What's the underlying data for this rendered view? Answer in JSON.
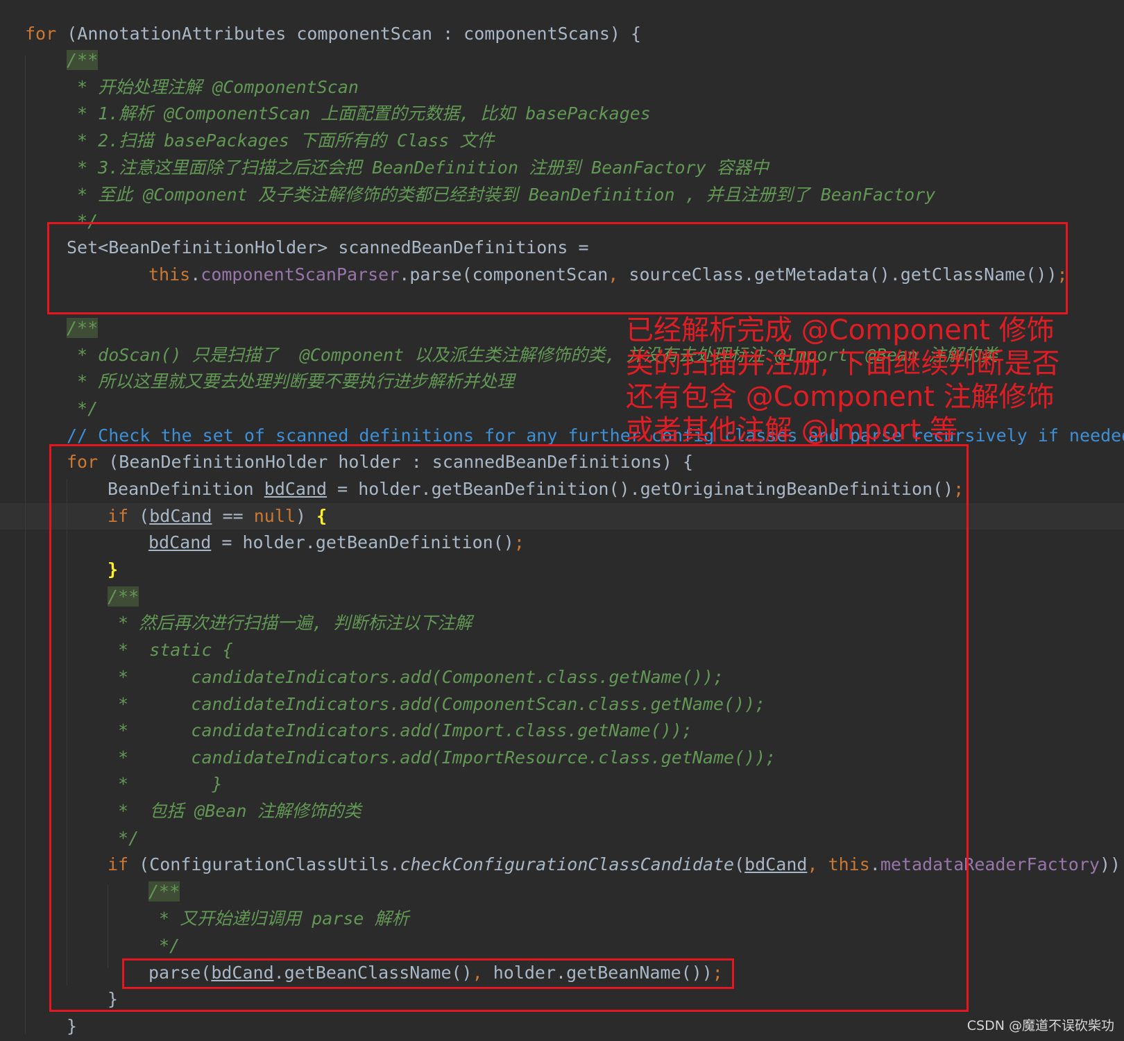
{
  "code_lines": [
    [
      {
        "t": "for ",
        "c": "kw"
      },
      {
        "t": "(AnnotationAttributes componentScan : componentScans) {"
      }
    ],
    [
      {
        "t": "/**",
        "c": "cmd"
      }
    ],
    [
      {
        "t": " * 开始处理注解 @ComponentScan",
        "c": "cm"
      }
    ],
    [
      {
        "t": " * 1.解析 @ComponentScan 上面配置的元数据, 比如 basePackages",
        "c": "cm"
      }
    ],
    [
      {
        "t": " * 2.扫描 basePackages 下面所有的 Class 文件",
        "c": "cm"
      }
    ],
    [
      {
        "t": " * 3.注意这里面除了扫描之后还会把 BeanDefinition 注册到 BeanFactory 容器中",
        "c": "cm"
      }
    ],
    [
      {
        "t": " * 至此 @Component 及子类注解修饰的类都已经封装到 BeanDefinition , 并且注册到了 BeanFactory",
        "c": "cm"
      }
    ],
    [
      {
        "t": " */",
        "c": "cm"
      }
    ],
    [
      {
        "t": "Set<BeanDefinitionHolder> scannedBeanDefinitions ="
      }
    ],
    [
      {
        "t": "this",
        "c": "kw"
      },
      {
        "t": "."
      },
      {
        "t": "componentScanParser",
        "c": "fld"
      },
      {
        "t": ".parse(componentScan"
      },
      {
        "t": ", ",
        "c": "kw"
      },
      {
        "t": "sourceClass.getMetadata().getClassName())"
      },
      {
        "t": ";",
        "c": "kw"
      }
    ],
    [
      {
        "t": "/**",
        "c": "cmd"
      }
    ],
    [
      {
        "t": " * doScan() 只是扫描了  @Component 以及派生类注解修饰的类, 并没有去处理标注 @Import、@Bean 注解的类",
        "c": "cm"
      }
    ],
    [
      {
        "t": " * 所以这里就又要去处理判断要不要执行进步解析并处理",
        "c": "cm"
      }
    ],
    [
      {
        "t": " */",
        "c": "cm"
      }
    ],
    [
      {
        "t": "// Check the set of scanned definitions for any further config classes and parse recursively if needed",
        "c": "lc"
      }
    ],
    [
      {
        "t": "for ",
        "c": "kw"
      },
      {
        "t": "(BeanDefinitionHolder holder : scannedBeanDefinitions) {"
      }
    ],
    [
      {
        "t": "BeanDefinition "
      },
      {
        "t": "bdCand",
        "c": "ul"
      },
      {
        "t": " = holder.getBeanDefinition().getOriginatingBeanDefinition()"
      },
      {
        "t": ";",
        "c": "kw"
      }
    ],
    [
      {
        "t": "if ",
        "c": "kw"
      },
      {
        "t": "("
      },
      {
        "t": "bdCand",
        "c": "ul"
      },
      {
        "t": " == "
      },
      {
        "t": "null",
        "c": "kw"
      },
      {
        "t": ") "
      },
      {
        "t": "{",
        "c": "br"
      }
    ],
    [
      {
        "t": "bdCand",
        "c": "ul"
      },
      {
        "t": " = holder.getBeanDefinition()"
      },
      {
        "t": ";",
        "c": "kw"
      }
    ],
    [
      {
        "t": "}",
        "c": "br"
      }
    ],
    [
      {
        "t": "/**",
        "c": "cmd"
      }
    ],
    [
      {
        "t": " * 然后再次进行扫描一遍, 判断标注以下注解",
        "c": "cm"
      }
    ],
    [
      {
        "t": " *  static {",
        "c": "cm"
      }
    ],
    [
      {
        "t": " *      candidateIndicators.add(Component.class.getName());",
        "c": "cm"
      }
    ],
    [
      {
        "t": " *      candidateIndicators.add(ComponentScan.class.getName());",
        "c": "cm"
      }
    ],
    [
      {
        "t": " *      candidateIndicators.add(Import.class.getName());",
        "c": "cm"
      }
    ],
    [
      {
        "t": " *      candidateIndicators.add(ImportResource.class.getName());",
        "c": "cm"
      }
    ],
    [
      {
        "t": " *        }",
        "c": "cm"
      }
    ],
    [
      {
        "t": " *  包括 @Bean 注解修饰的类",
        "c": "cm"
      }
    ],
    [
      {
        "t": " */",
        "c": "cm"
      }
    ],
    [
      {
        "t": "if ",
        "c": "kw"
      },
      {
        "t": "(ConfigurationClassUtils."
      },
      {
        "t": "checkConfigurationClassCandidate",
        "c": "it"
      },
      {
        "t": "("
      },
      {
        "t": "bdCand",
        "c": "ul"
      },
      {
        "t": ", ",
        "c": "kw"
      },
      {
        "t": "this",
        "c": "kw"
      },
      {
        "t": "."
      },
      {
        "t": "metadataReaderFactory",
        "c": "fld"
      },
      {
        "t": ")) {"
      }
    ],
    [
      {
        "t": "/**",
        "c": "cmd"
      }
    ],
    [
      {
        "t": " * 又开始递归调用 parse 解析",
        "c": "cm"
      }
    ],
    [
      {
        "t": " */",
        "c": "cm"
      }
    ],
    [
      {
        "t": "parse("
      },
      {
        "t": "bdCand",
        "c": "ul"
      },
      {
        "t": ".getBeanClassName()"
      },
      {
        "t": ", ",
        "c": "kw"
      },
      {
        "t": "holder.getBeanName())"
      },
      {
        "t": ";",
        "c": "kw"
      }
    ],
    [
      {
        "t": "}"
      }
    ],
    [
      {
        "t": "}"
      }
    ]
  ],
  "annotation": {
    "note": "已经解析完成 @Component 修饰类的扫描并注册, 下面继续判断是否还有包含 @Component 注解修饰或者其他注解 @Import 等"
  },
  "watermark": "CSDN @魔道不误砍柴功",
  "colors": {
    "background": "#2b2b2b",
    "keyword": "#cc7832",
    "comment": "#629755",
    "field": "#9876aa",
    "line_comment": "#3d8fd6",
    "highlight_box": "#e5161e"
  }
}
